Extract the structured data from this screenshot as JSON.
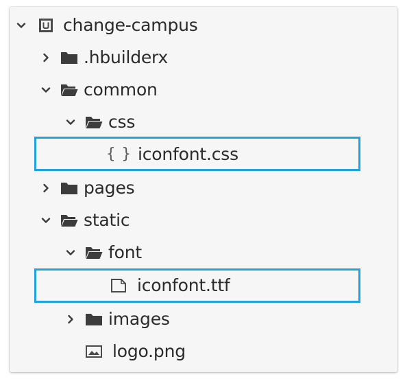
{
  "tree": {
    "root": {
      "label": "change-campus",
      "expanded": true,
      "icon": "project-icon"
    },
    "items": [
      {
        "label": ".hbuilderx",
        "type": "folder",
        "expanded": false
      },
      {
        "label": "common",
        "type": "folder",
        "expanded": true
      },
      {
        "label": "css",
        "type": "folder",
        "expanded": true
      },
      {
        "label": "iconfont.css",
        "type": "css-file",
        "highlighted": true
      },
      {
        "label": "pages",
        "type": "folder",
        "expanded": false
      },
      {
        "label": "static",
        "type": "folder",
        "expanded": true
      },
      {
        "label": "font",
        "type": "folder",
        "expanded": true
      },
      {
        "label": "iconfont.ttf",
        "type": "file",
        "highlighted": true
      },
      {
        "label": "images",
        "type": "folder",
        "expanded": false
      },
      {
        "label": "logo.png",
        "type": "image-file"
      }
    ]
  },
  "colors": {
    "highlight_border": "#1ea3dc",
    "icon": "#3c3c3c",
    "text": "#2b2b2b",
    "panel_bg": "#f6f6f6"
  }
}
